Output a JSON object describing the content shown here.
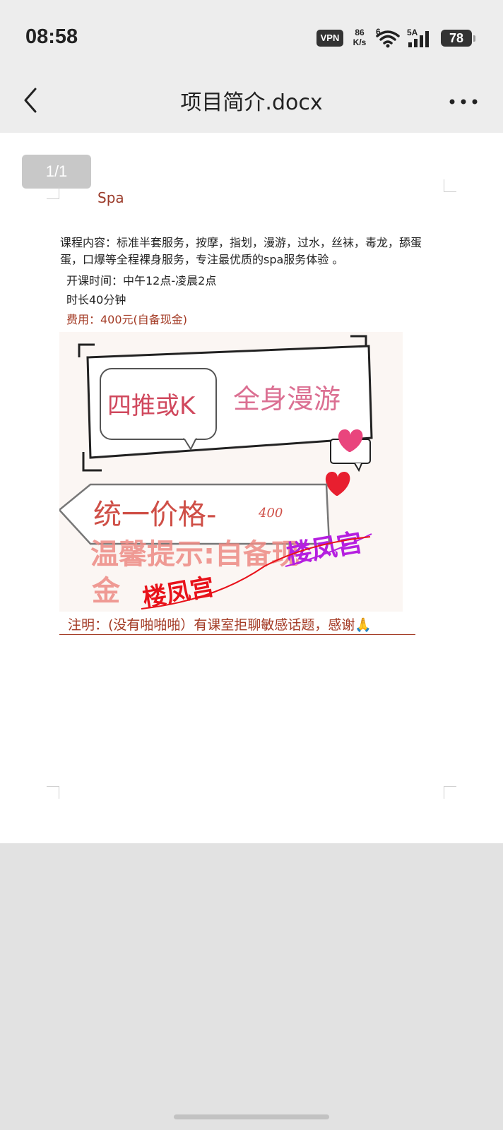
{
  "status_bar": {
    "time": "08:58",
    "vpn": "VPN",
    "net_speed_value": "86",
    "net_speed_unit": "K/s",
    "wifi_badge": "6",
    "cell_badge": "5A",
    "battery": "78"
  },
  "title_bar": {
    "title": "项目简介.docx",
    "back_icon": "chevron-left-icon",
    "more_icon": "more-horizontal-icon"
  },
  "document": {
    "page_indicator": "1/1",
    "heading": "Spa",
    "content": "课程内容：标准半套服务，按摩，指划，漫游，过水，丝袜，毒龙，舔蛋蛋，口爆等全程裸身服务，专注最优质的spa服务体验 。",
    "hours": "开课时间：中午12点-凌晨2点",
    "duration": "时长40分钟",
    "fee": "费用：400元(自备现金)",
    "promo_image": {
      "tag_left": "四推或K",
      "tag_right": "全身漫游",
      "price_label": "统一价格-",
      "price_value": "400",
      "tip_line1": "温馨提示:自备现",
      "tip_line2": "金",
      "watermark_red": "楼凤宫",
      "watermark_purple": "楼凤宫"
    },
    "notice": "注明：(没有啪啪啪）有课室拒聊敏感话题，感谢🙏"
  },
  "colors": {
    "accent_red": "#a33a24",
    "background": "#e2e2e2",
    "page": "#ffffff"
  }
}
